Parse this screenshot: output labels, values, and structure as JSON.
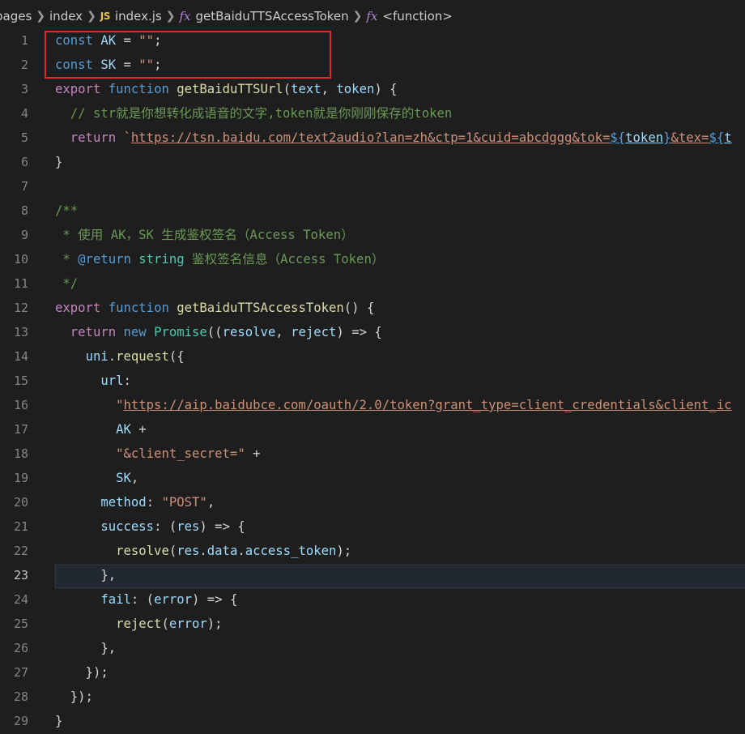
{
  "breadcrumb": {
    "items": [
      "pages",
      "index",
      "index.js",
      "getBaiduTTSAccessToken",
      "<function>"
    ],
    "js_badge": "JS",
    "fx_icon": "fx"
  },
  "editor": {
    "active_line": 23,
    "lines": [
      {
        "n": "1",
        "text": "const AK = \"\";"
      },
      {
        "n": "2",
        "text": "const SK = \"\";"
      },
      {
        "n": "3",
        "text": "export function getBaiduTTSUrl(text, token) {"
      },
      {
        "n": "4",
        "text": "  // str就是你想转化成语音的文字,token就是你刚刚保存的token"
      },
      {
        "n": "5",
        "text": "  return `https://tsn.baidu.com/text2audio?lan=zh&ctp=1&cuid=abcdggg&tok=${token}&tex=${t"
      },
      {
        "n": "6",
        "text": "}"
      },
      {
        "n": "7",
        "text": ""
      },
      {
        "n": "8",
        "text": "/**"
      },
      {
        "n": "9",
        "text": " * 使用 AK，SK 生成鉴权签名（Access Token）"
      },
      {
        "n": "10",
        "text": " * @return string 鉴权签名信息（Access Token）"
      },
      {
        "n": "11",
        "text": " */"
      },
      {
        "n": "12",
        "text": "export function getBaiduTTSAccessToken() {"
      },
      {
        "n": "13",
        "text": "  return new Promise((resolve, reject) => {"
      },
      {
        "n": "14",
        "text": "    uni.request({"
      },
      {
        "n": "15",
        "text": "      url:"
      },
      {
        "n": "16",
        "text": "        \"https://aip.baidubce.com/oauth/2.0/token?grant_type=client_credentials&client_ic"
      },
      {
        "n": "17",
        "text": "        AK +"
      },
      {
        "n": "18",
        "text": "        \"&client_secret=\" +"
      },
      {
        "n": "19",
        "text": "        SK,"
      },
      {
        "n": "20",
        "text": "      method: \"POST\","
      },
      {
        "n": "21",
        "text": "      success: (res) => {"
      },
      {
        "n": "22",
        "text": "        resolve(res.data.access_token);"
      },
      {
        "n": "23",
        "text": "      },"
      },
      {
        "n": "24",
        "text": "      fail: (error) => {"
      },
      {
        "n": "25",
        "text": "        reject(error);"
      },
      {
        "n": "26",
        "text": "      },"
      },
      {
        "n": "27",
        "text": "    });"
      },
      {
        "n": "28",
        "text": "  });"
      },
      {
        "n": "29",
        "text": "}"
      }
    ]
  },
  "colors": {
    "background": "#1e1e1e",
    "keyword": "#569cd6",
    "control_keyword": "#c586c0",
    "function": "#dcdcaa",
    "variable": "#9cdcfe",
    "string": "#ce9178",
    "comment": "#6a9955",
    "class": "#4ec9b0",
    "highlight_box": "#e12b2b"
  }
}
